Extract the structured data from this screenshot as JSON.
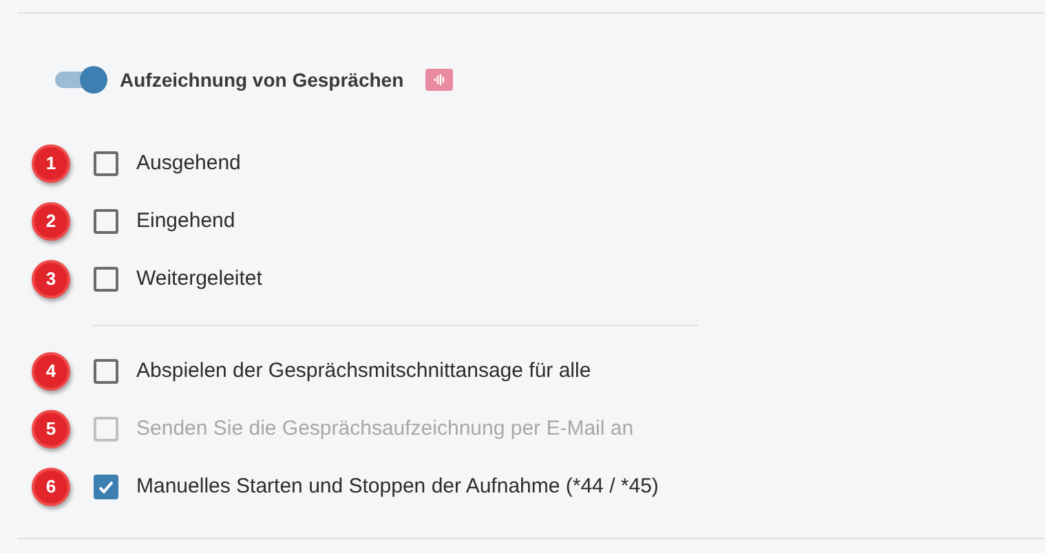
{
  "header": {
    "toggle_on": true,
    "title": "Aufzeichnung von Gesprächen"
  },
  "groups": [
    [
      {
        "marker": "1",
        "label": "Ausgehend",
        "checked": false,
        "disabled": false
      },
      {
        "marker": "2",
        "label": "Eingehend",
        "checked": false,
        "disabled": false
      },
      {
        "marker": "3",
        "label": "Weitergeleitet",
        "checked": false,
        "disabled": false
      }
    ],
    [
      {
        "marker": "4",
        "label": "Abspielen der Gesprächsmitschnittansage für alle",
        "checked": false,
        "disabled": false
      },
      {
        "marker": "5",
        "label": "Senden Sie die Gesprächsaufzeichnung per E-Mail an",
        "checked": false,
        "disabled": true
      },
      {
        "marker": "6",
        "label": "Manuelles Starten und Stoppen der Aufnahme (*44 / *45)",
        "checked": true,
        "disabled": false
      }
    ]
  ]
}
